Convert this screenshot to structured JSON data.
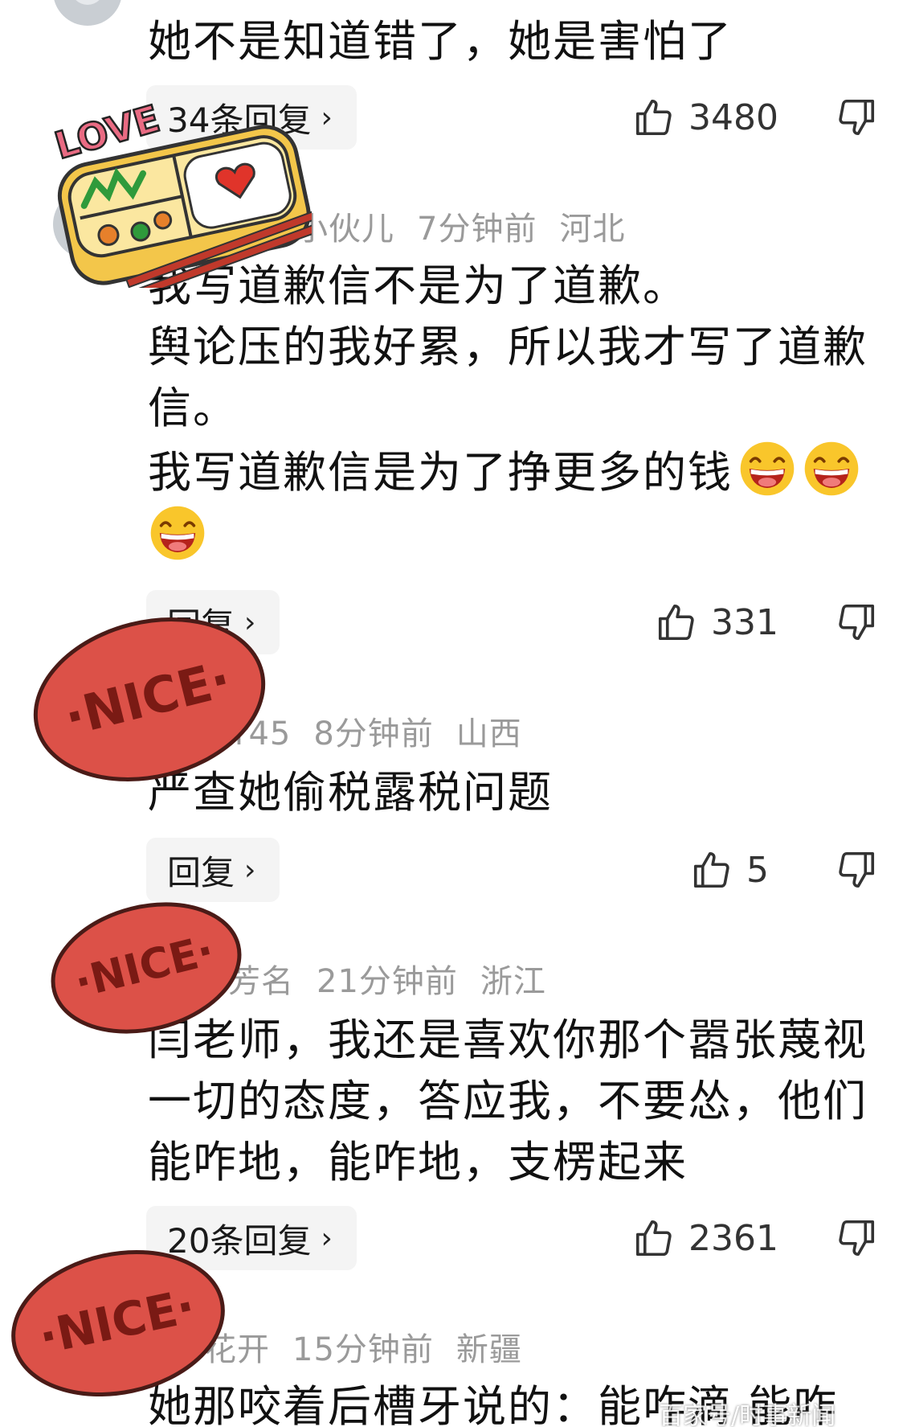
{
  "comments": [
    {
      "id": "c1",
      "body": "她不是知道错了，她是害怕了",
      "reply_label": "34条回复",
      "likes": "3480"
    },
    {
      "id": "c2",
      "username": "小伙儿",
      "time": "7分钟前",
      "location": "河北",
      "body": "我写道歉信不是为了道歉。\n舆论压的我好累，所以我才写了道歉信。\n我写道歉信是为了挣更多的钱",
      "reply_label": "回复",
      "likes": "331"
    },
    {
      "id": "c3",
      "username": "r45",
      "time": "8分钟前",
      "location": "山西",
      "body": "严查她偷税露税问题",
      "reply_label": "回复",
      "likes": "5"
    },
    {
      "id": "c4",
      "username": "芳名",
      "time": "21分钟前",
      "location": "浙江",
      "body": "闫老师，我还是喜欢你那个嚣张蔑视一切的态度，答应我，不要怂，他们能咋地，能咋地，支楞起来",
      "reply_label": "20条回复",
      "likes": "2361"
    },
    {
      "id": "c5",
      "username": "花开",
      "time": "15分钟前",
      "location": "新疆",
      "body": "她那咬着后槽牙说的：能咋滴 能咋"
    }
  ],
  "stickers": {
    "love_text": "LOVE",
    "nice_text": "·NICE·"
  },
  "watermark": "百家号/时事新闻",
  "icons": {
    "like": "thumbs-up-icon",
    "dislike": "thumbs-down-icon",
    "chevron": "chevron-right-icon",
    "emoji": "laughing-emoji-icon"
  },
  "colors": {
    "meta_gray": "#9a9a9a",
    "pill_bg": "#f4f4f4",
    "nice_red": "#dc5148",
    "lunchbox_yellow": "#f3c64a"
  }
}
